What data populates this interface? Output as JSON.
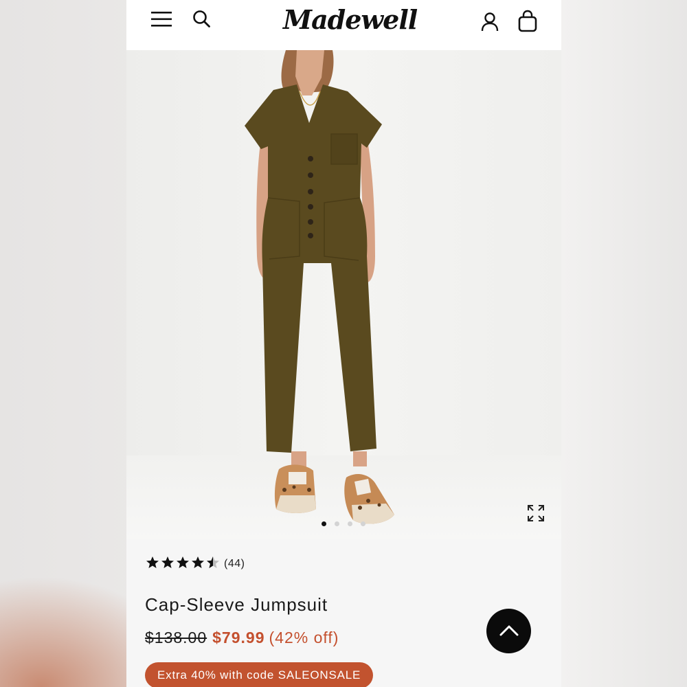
{
  "header": {
    "brand_logo": "Madewell",
    "icons": [
      "menu-icon",
      "search-icon",
      "account-icon",
      "bag-icon"
    ]
  },
  "gallery": {
    "image_count": 4,
    "active_index": 0,
    "icons": [
      "expand-icon"
    ]
  },
  "product": {
    "rating": 4.5,
    "rating_max": 5,
    "review_count": "(44)",
    "name": "Cap-Sleeve Jumpsuit",
    "price_original": "$138.00",
    "price_sale": "$79.99",
    "discount": "(42% off)",
    "promo": "Extra 40% with code SALEONSALE"
  },
  "scroll_top": {
    "icon": "chevron-up-icon"
  },
  "colors": {
    "accent": "#c4502e",
    "promo_bg": "#c2532f",
    "garment": "#5a4a1f",
    "text": "#1a1a1a"
  }
}
